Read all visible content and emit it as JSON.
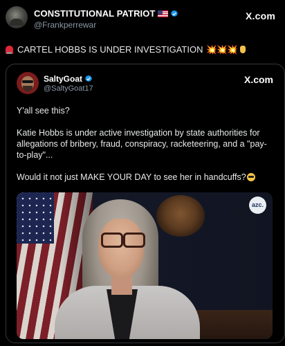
{
  "outer_post": {
    "author_name": "CONSTITUTIONAL PATRIOT",
    "handle": "@Frankperrewar",
    "source": "X.com",
    "text": "CARTEL HOBBS IS UNDER INVESTIGATION",
    "trailing_emoji": "💥💥💥"
  },
  "quoted_post": {
    "author_name": "SaltyGoat",
    "handle": "@SaltyGoat17",
    "source": "X.com",
    "paragraphs": [
      "Y'all see this?",
      "Katie Hobbs is under active investigation by state authorities for allegations of bribery, fraud, conspiracy, racketeering, and a \"pay-to-play\"...",
      "Would it not just MAKE YOUR DAY to see her in handcuffs?"
    ],
    "media_badge": "azc."
  },
  "colors": {
    "background": "#000000",
    "verified_blue": "#1d9bf0",
    "secondary_text": "#8b98a5",
    "border": "#333639"
  },
  "icons": [
    "us-flag-icon",
    "verified-badge-icon",
    "siren-icon",
    "explosion-icon",
    "pointing-down-icon",
    "sunglasses-emoji-icon"
  ]
}
